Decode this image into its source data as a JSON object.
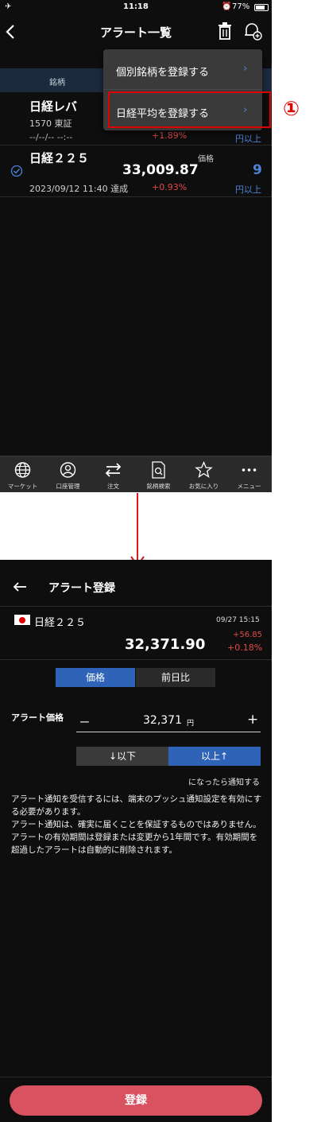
{
  "screen1": {
    "status": {
      "time": "11:18",
      "battery": "77%"
    },
    "nav": {
      "title": "アラート一覧"
    },
    "table_header": {
      "col_name": "銘柄"
    },
    "dropdown": {
      "item1": "個別銘柄を登録する",
      "item2": "日経平均を登録する"
    },
    "annotation": {
      "marker": "①"
    },
    "rows": [
      {
        "name": "日経レバ",
        "code": "1570 東証",
        "date": "--/--/-- --:--",
        "change": "+1.89%",
        "unit": "円以上"
      },
      {
        "name": "日経２２５",
        "price_label": "価格",
        "price": "33,009.87",
        "threshold": "9",
        "date": "2023/09/12 11:40 達成",
        "change": "+0.93%",
        "unit": "円以上"
      }
    ],
    "tabs": [
      {
        "label": "マーケット",
        "icon": "globe-icon"
      },
      {
        "label": "口座管理",
        "icon": "user-icon"
      },
      {
        "label": "注文",
        "icon": "swap-arrows-icon"
      },
      {
        "label": "銘柄検索",
        "icon": "doc-search-icon"
      },
      {
        "label": "お気に入り",
        "icon": "star-icon"
      },
      {
        "label": "メニュー",
        "icon": "more-dots-icon"
      }
    ]
  },
  "screen2": {
    "nav": {
      "title": "アラート登録"
    },
    "stock": {
      "name": "日経２２５",
      "datetime": "09/27 15:15",
      "price": "32,371.90",
      "change": "+56.85",
      "change_pct": "+0.18%"
    },
    "segment": {
      "opt1": "価格",
      "opt2": "前日比"
    },
    "alert": {
      "label": "アラート価格",
      "minus": "ー",
      "value": "32,371",
      "unit": "円",
      "plus": "+"
    },
    "direction": {
      "below": "↓以下",
      "above": "以上↑"
    },
    "notify_text": "になったら通知する",
    "info": [
      "アラート通知を受信するには、端末のプッシュ通知設定を有効にする必要があります。",
      "アラート通知は、確実に届くことを保証するものではありません。",
      "アラートの有効期間は登録または変更から1年間です。有効期間を超過したアラートは自動的に削除されます。"
    ],
    "register_label": "登録"
  },
  "colors": {
    "accent_blue": "#2f63b8",
    "register_red": "#d9525f",
    "annotation_red": "#e00000"
  }
}
